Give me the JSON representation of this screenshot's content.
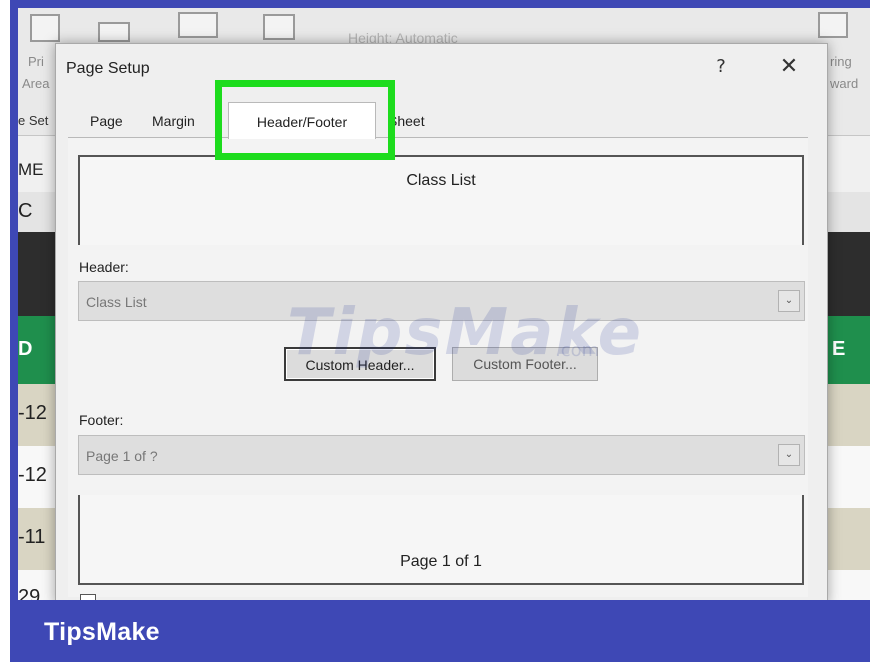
{
  "brand": {
    "name": "TipsMake"
  },
  "background": {
    "ribbon": {
      "print_area_label": "Pri",
      "print_area_label2": "Area",
      "page_setup_group": "e Set",
      "height_field": "Height: Automatic",
      "right_label_1": "ring",
      "right_label_2": "ward"
    },
    "left_cells": [
      "ME",
      "C",
      "D",
      "-12",
      "-12",
      "-11",
      "29"
    ],
    "right_cell": "E",
    "colors": {
      "dark_row": "#2d2d2d",
      "green_row": "#1f8f4d",
      "tan_row": "#d9d5c3"
    }
  },
  "dialog": {
    "title": "Page Setup",
    "help_label": "?",
    "close_label": "✕",
    "tabs": [
      {
        "label": "Page",
        "active": false
      },
      {
        "label": "Margin",
        "active": false
      },
      {
        "label": "Header/Footer",
        "active": true
      },
      {
        "label": "Sheet",
        "active": false
      }
    ],
    "header_preview_text": "Class List",
    "header_label": "Header:",
    "header_value": "Class List",
    "custom_header_label": "Custom Header...",
    "custom_footer_label": "Custom Footer...",
    "footer_label": "Footer:",
    "footer_value": "Page 1 of ?",
    "footer_preview_text": "Page 1 of 1",
    "combo_arrow": "⌄",
    "highlight_color": "#1ddc1d"
  },
  "watermark": {
    "text": "TipsMake",
    "suffix": ".com"
  }
}
